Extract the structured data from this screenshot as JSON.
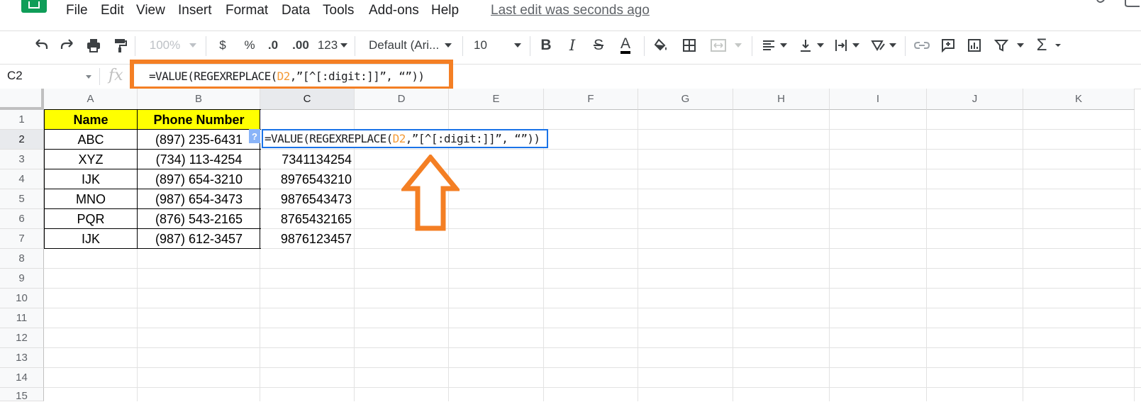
{
  "menu": {
    "items": [
      "File",
      "Edit",
      "View",
      "Insert",
      "Format",
      "Data",
      "Tools",
      "Add-ons",
      "Help"
    ],
    "last_edit": "Last edit was seconds ago"
  },
  "toolbar": {
    "zoom": "100%",
    "currency": "$",
    "percent": "%",
    "decrease_decimal": ".0",
    "increase_decimal": ".00",
    "more_formats": "123",
    "font": "Default (Ari...",
    "font_size": "10",
    "bold": "B",
    "italic": "I",
    "strikethrough": "S",
    "text_color_letter": "A",
    "sum": "Σ"
  },
  "formula_bar": {
    "name_box": "C2",
    "fx": "fx",
    "formula_prefix": "=VALUE(REGEXREPLACE(",
    "formula_ref": "D2",
    "formula_suffix": ",”[^[:digit:]]”, “”))"
  },
  "columns": [
    "A",
    "B",
    "C",
    "D",
    "E",
    "F",
    "G",
    "H",
    "I",
    "J",
    "K"
  ],
  "rows": [
    "1",
    "2",
    "3",
    "4",
    "5",
    "6",
    "7",
    "8",
    "9",
    "10",
    "11",
    "12",
    "13",
    "14",
    "15"
  ],
  "table": {
    "headers": [
      "Name",
      "Phone Number"
    ],
    "names": [
      "ABC",
      "XYZ",
      "IJK",
      "MNO",
      "PQR",
      "IJK"
    ],
    "phones": [
      "(897) 235-6431",
      "(734) 113-4254",
      "(897) 654-3210",
      "(987) 654-3473",
      "(876) 543-2165",
      "(987) 612-3457"
    ],
    "results": [
      "",
      "7341134254",
      "8976543210",
      "9876543473",
      "8765432165",
      "9876123457"
    ]
  },
  "cell_editor": {
    "help": "?",
    "formula_prefix": "=VALUE(REGEXREPLACE(",
    "formula_ref": "D2",
    "formula_suffix": ",”[^[:digit:]]”, “”))"
  },
  "colors": {
    "highlight_box": "#f47f24",
    "arrow": "#f47f24",
    "header_fill": "#ffff00",
    "editor_border": "#1a73e8",
    "formula_ref": "#f49b38"
  }
}
